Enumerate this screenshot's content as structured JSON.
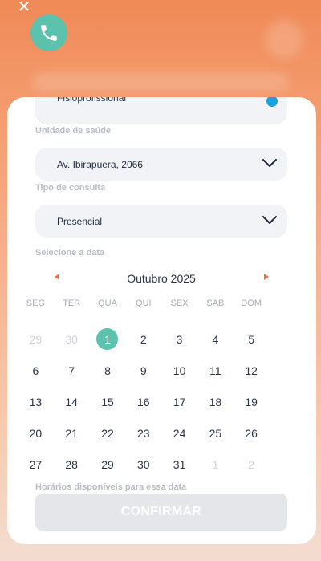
{
  "header": {
    "close_icon": "close-icon",
    "phone_icon": "phone-icon",
    "accent_color": "#5cc1ad"
  },
  "form": {
    "professional_value": "Fisioprofissional",
    "unit_label": "Unidade de saúde",
    "unit_value": "Av. Ibirapuera, 2066",
    "consult_label": "Tipo de consulta",
    "consult_value": "Presencial",
    "date_label": "Selecione a data"
  },
  "calendar": {
    "month": "Outubro 2025",
    "prev_icon": "chevron-left-icon",
    "next_icon": "chevron-right-icon",
    "weekdays": [
      "SEG",
      "TER",
      "QUA",
      "QUI",
      "SEX",
      "SAB",
      "DOM"
    ],
    "selected": "1",
    "days": [
      {
        "d": "29",
        "muted": true
      },
      {
        "d": "30",
        "muted": true
      },
      {
        "d": "1",
        "selected": true
      },
      {
        "d": "2"
      },
      {
        "d": "3"
      },
      {
        "d": "4"
      },
      {
        "d": "5"
      },
      {
        "d": "6"
      },
      {
        "d": "7"
      },
      {
        "d": "8"
      },
      {
        "d": "9"
      },
      {
        "d": "10"
      },
      {
        "d": "11"
      },
      {
        "d": "12"
      },
      {
        "d": "13"
      },
      {
        "d": "14"
      },
      {
        "d": "15"
      },
      {
        "d": "16"
      },
      {
        "d": "17"
      },
      {
        "d": "18"
      },
      {
        "d": "19"
      },
      {
        "d": "20"
      },
      {
        "d": "21"
      },
      {
        "d": "22"
      },
      {
        "d": "23"
      },
      {
        "d": "24"
      },
      {
        "d": "25"
      },
      {
        "d": "26"
      },
      {
        "d": "27"
      },
      {
        "d": "28"
      },
      {
        "d": "29"
      },
      {
        "d": "30"
      },
      {
        "d": "31"
      },
      {
        "d": "1",
        "muted": true
      },
      {
        "d": "2",
        "muted": true
      }
    ]
  },
  "slots": {
    "label": "Horários disponíveis para essa data"
  },
  "actions": {
    "confirm_label": "CONFIRMAR"
  }
}
